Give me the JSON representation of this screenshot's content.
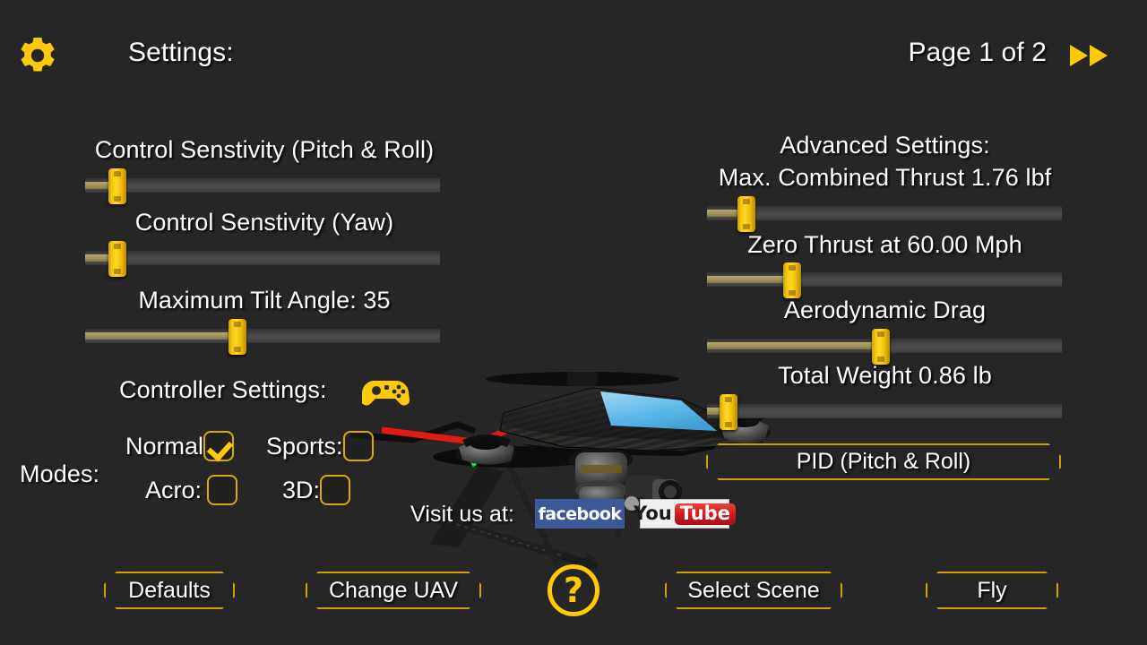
{
  "header": {
    "gear_icon": "gear-icon",
    "title": "Settings:",
    "page_indicator": "Page 1 of 2",
    "next_arrow_icon": "fast-forward-icon"
  },
  "left_column": {
    "sliders": [
      {
        "label": "Control Senstivity (Pitch & Roll)",
        "value_percent": 9
      },
      {
        "label": "Control Senstivity (Yaw)",
        "value_percent": 9
      },
      {
        "label": "Maximum Tilt Angle: 35",
        "value_percent": 43
      }
    ]
  },
  "right_column": {
    "sliders": [
      {
        "label": "Advanced Settings:",
        "label2": "Max. Combined Thrust 1.76 lbf",
        "value_percent": 11
      },
      {
        "label": "Zero Thrust at 60.00 Mph",
        "value_percent": 24
      },
      {
        "label": "Aerodynamic Drag",
        "value_percent": 49
      },
      {
        "label": "Total Weight 0.86 lb",
        "value_percent": 6
      }
    ],
    "pid_button": "PID (Pitch & Roll)"
  },
  "controller": {
    "label": "Controller Settings:",
    "gamepad_icon": "gamepad-icon",
    "modes_label": "Modes:",
    "modes": [
      {
        "label": "Normal",
        "checked": true
      },
      {
        "label": "Sports:",
        "checked": false
      },
      {
        "label": "Acro:",
        "checked": false
      },
      {
        "label": "3D:",
        "checked": false
      }
    ]
  },
  "social": {
    "visit_label": "Visit us at:",
    "facebook_label": "facebook",
    "youtube_you": "You",
    "youtube_tube": "Tube"
  },
  "footer": {
    "defaults": "Defaults",
    "change_uav": "Change UAV",
    "help": "?",
    "select_scene": "Select Scene",
    "fly": "Fly"
  },
  "colors": {
    "background": "#262626",
    "accent_yellow": "#ffc90b",
    "border_gold": "#d0a00c",
    "slider_fill": "#9d8f5d",
    "facebook_blue": "#3b5998",
    "youtube_red": "#cc181e"
  }
}
